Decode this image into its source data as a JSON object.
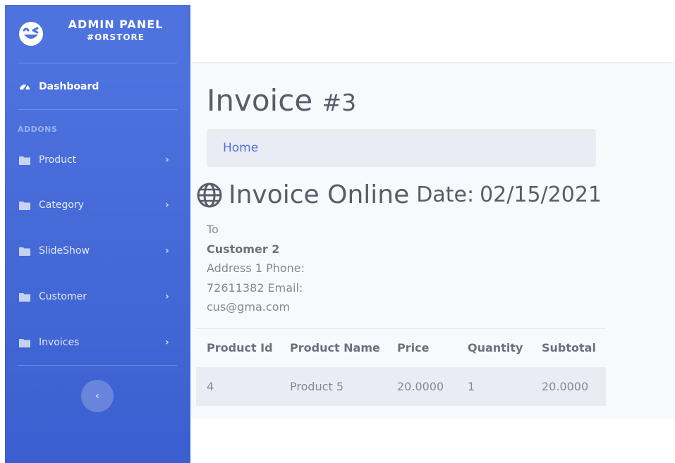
{
  "brand": {
    "title": "ADMIN PANEL",
    "subtitle": "#ORSTORE",
    "icon": "laugh-wink-icon"
  },
  "sidebar": {
    "dashboard": {
      "label": "Dashboard",
      "icon": "tachometer-icon"
    },
    "heading": "ADDONS",
    "items": [
      {
        "label": "Product",
        "icon": "folder-icon"
      },
      {
        "label": "Category",
        "icon": "folder-icon"
      },
      {
        "label": "SlideShow",
        "icon": "folder-icon"
      },
      {
        "label": "Customer",
        "icon": "folder-icon"
      },
      {
        "label": "Invoices",
        "icon": "folder-icon"
      }
    ],
    "toggle_label": "‹"
  },
  "page": {
    "title": "Invoice",
    "number": "#3"
  },
  "breadcrumb": {
    "home": "Home"
  },
  "invoice": {
    "heading": "Invoice Online",
    "date_label": "Date:",
    "date_value": "02/15/2021",
    "to_label": "To",
    "customer": "Customer 2",
    "address_line": "Address 1 Phone:",
    "phone_line": "72611382 Email:",
    "email": "cus@gma.com"
  },
  "table": {
    "headers": [
      "Product Id",
      "Product Name",
      "Price",
      "Quantity",
      "Subtotal"
    ],
    "rows": [
      [
        "4",
        "Product 5",
        "20.0000",
        "1",
        "20.0000"
      ]
    ]
  },
  "colors": {
    "primary": "#4e73df",
    "text": "#5a5c69",
    "muted": "#858796",
    "bg": "#f8f9fc"
  }
}
